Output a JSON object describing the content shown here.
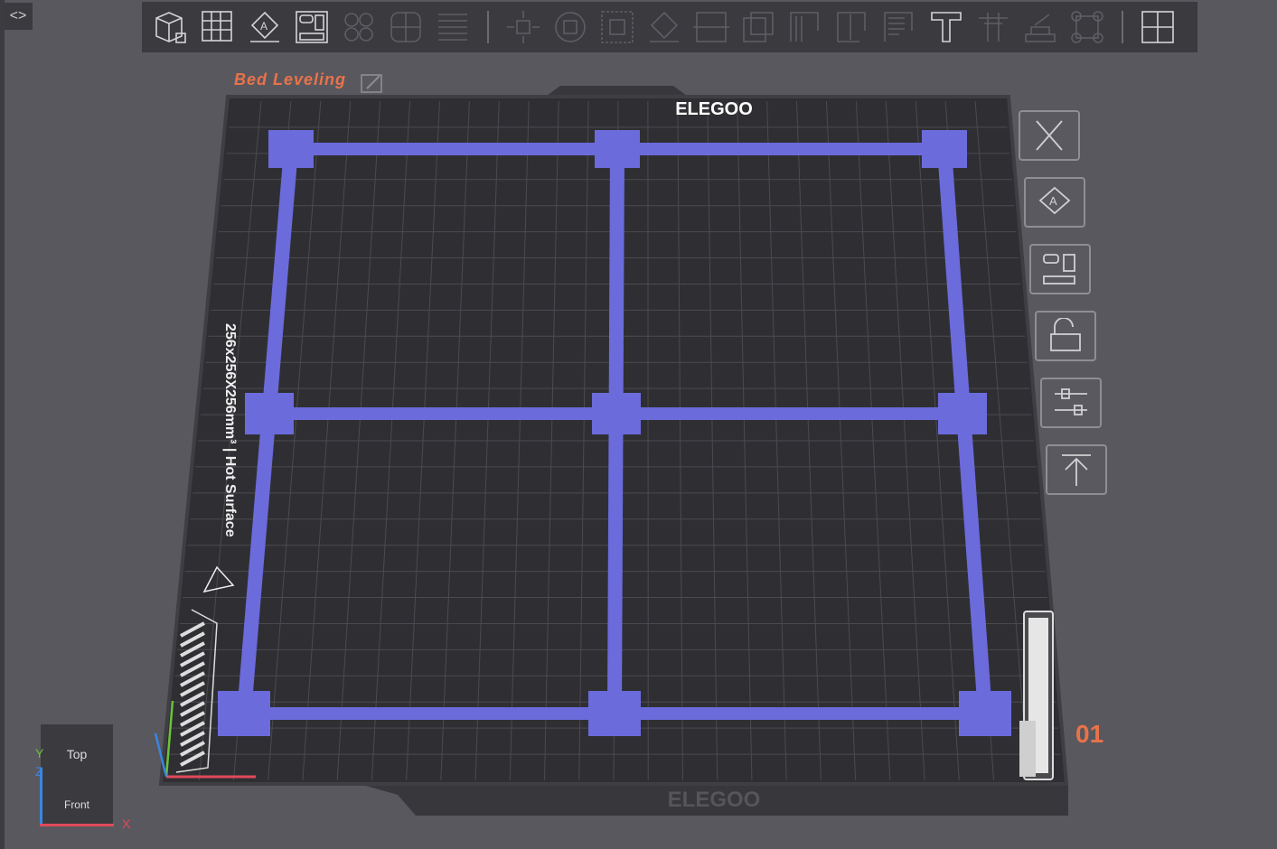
{
  "toolbar": {
    "left_icons": [
      "add-object-icon",
      "add-plate-icon",
      "auto-orient-icon",
      "arrange-icon",
      "split-objects-icon",
      "split-parts-icon",
      "layers-icon"
    ],
    "right_icons": [
      "move-icon",
      "rotate-icon",
      "scale-icon",
      "lay-on-face-icon",
      "cut-icon",
      "boolean-icon",
      "support-paint-icon",
      "seam-paint-icon",
      "fuzzy-skin-icon",
      "text-icon",
      "measure-icon",
      "brim-ears-icon",
      "assembly-icon",
      "puzzle-icon"
    ]
  },
  "plate": {
    "label": "Bed Leveling",
    "brand": "ELEGOO",
    "bed_spec": "256x256X256mm³ | Hot Surface"
  },
  "colors": {
    "accent": "#e8734a",
    "model": "#6b6bdc"
  },
  "slider": {
    "layer": "01",
    "fraction": 1.0
  },
  "view_cube": {
    "top": "Top",
    "front": "Front",
    "axis_x": "X",
    "axis_y": "Y",
    "axis_z": "Z"
  }
}
